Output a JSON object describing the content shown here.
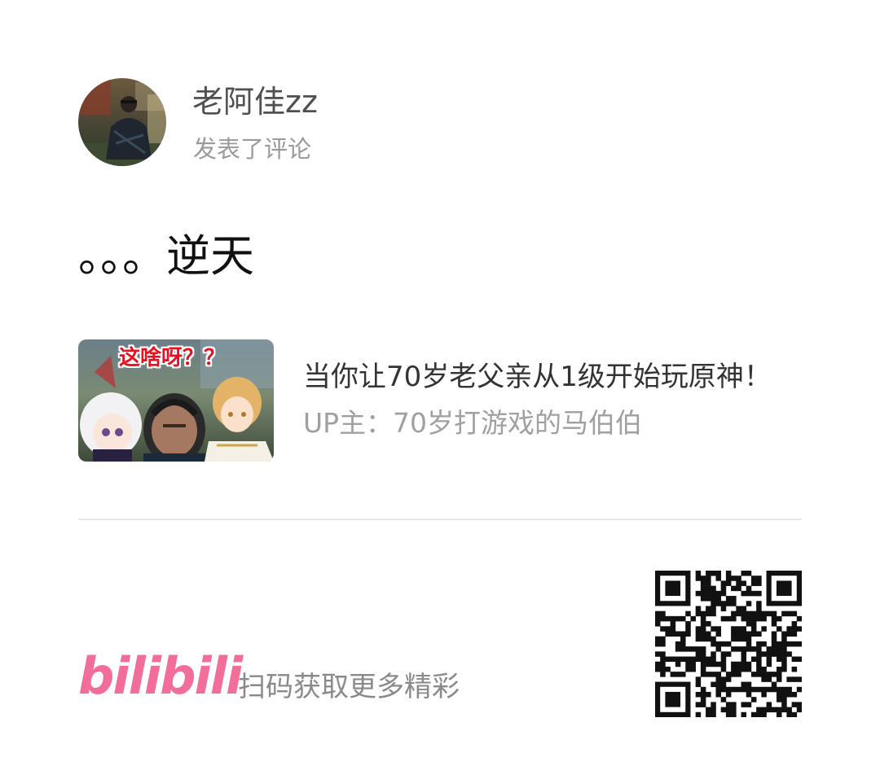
{
  "author": {
    "name": "老阿佳zz",
    "action": "发表了评论"
  },
  "comment": {
    "text": "。。。逆天"
  },
  "video": {
    "thumbnail_caption": "这啥呀？？",
    "title": "当你让70岁老父亲从1级开始玩原神！",
    "uploader": "UP主：70岁打游戏的马伯伯"
  },
  "footer": {
    "brand": "bilibili",
    "scan_text": "扫码获取更多精彩"
  },
  "colors": {
    "brand_pink": "#f26d99",
    "divider": "#e6e6e6",
    "caption_red": "#e8101e"
  }
}
